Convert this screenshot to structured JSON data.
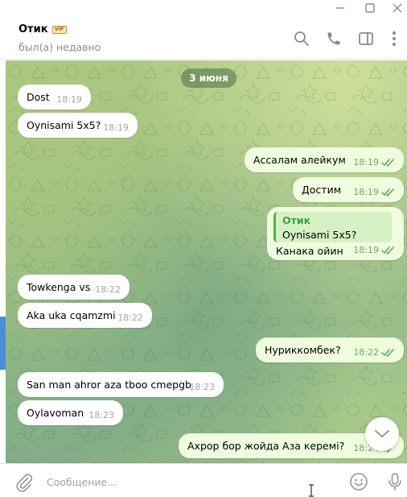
{
  "header": {
    "chat_name": "Отик",
    "badge": "VIP",
    "status": "был(а) недавно"
  },
  "icons": {
    "minimize": "minimize-icon",
    "maximize": "maximize-icon",
    "close": "close-icon",
    "search": "search-icon",
    "call": "phone-icon",
    "side_panel": "sidebar-toggle-icon",
    "more": "more-vertical-icon",
    "attach": "paperclip-icon",
    "emoji": "smile-icon",
    "voice": "microphone-icon",
    "scroll": "chevron-down-icon"
  },
  "date_separator": "3 июня",
  "messages": [
    {
      "dir": "in",
      "text": "Dost",
      "time": "18:19"
    },
    {
      "dir": "in",
      "text": "Oynisami 5x5?",
      "time": "18:19"
    },
    {
      "dir": "out",
      "text": "Ассалам алейкум",
      "time": "18:19",
      "read": true
    },
    {
      "dir": "out",
      "text": "Достим",
      "time": "18:19",
      "read": true
    },
    {
      "dir": "out",
      "reply_author": "Отик",
      "reply_text": "Oynisami 5x5?",
      "text": "Канака ойин",
      "time": "18:19",
      "read": true
    },
    {
      "dir": "in",
      "text": "Towkenga vs",
      "time": "18:22"
    },
    {
      "dir": "in",
      "text": "Aka uka cqamzmi",
      "time": "18:22"
    },
    {
      "dir": "out",
      "text": "Нуриккомбек?",
      "time": "18:22",
      "read": true
    },
    {
      "dir": "in",
      "text": "San man ahror aza tboo cmepgb",
      "time": "18:23"
    },
    {
      "dir": "in",
      "text": "Oylavoman",
      "time": "18:23"
    },
    {
      "dir": "out",
      "text": "Ахрор бор жойда Аза керемi?",
      "time": "18:24",
      "read": true
    }
  ],
  "composer": {
    "placeholder": "Сообщение..."
  },
  "colors": {
    "incoming_bubble": "#ffffff",
    "outgoing_bubble": "#effdde",
    "read_check": "#4fae4e",
    "reply_accent": "#52b24c",
    "date_pill": "#4a7046"
  }
}
